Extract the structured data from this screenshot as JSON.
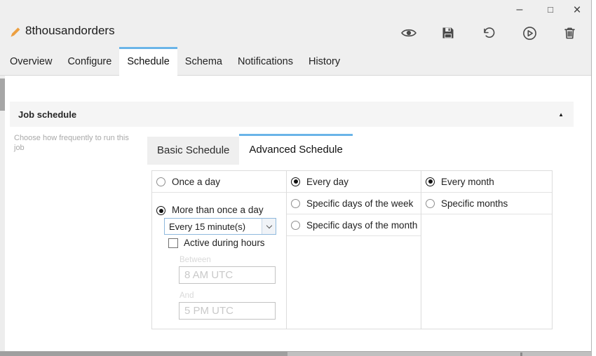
{
  "window": {
    "title": "8thousandorders",
    "controls": {
      "minimize_glyph": "–",
      "maximize_glyph": "□",
      "close_glyph": "×"
    }
  },
  "toolbar": {
    "buttons": [
      {
        "name": "preview",
        "icon": "eye-icon"
      },
      {
        "name": "save",
        "icon": "floppy-disk-icon"
      },
      {
        "name": "undo",
        "icon": "undo-arrow-icon"
      },
      {
        "name": "run",
        "icon": "play-circle-icon"
      },
      {
        "name": "delete",
        "icon": "trash-icon"
      }
    ]
  },
  "tabs": [
    {
      "label": "Overview",
      "active": false
    },
    {
      "label": "Configure",
      "active": false
    },
    {
      "label": "Schedule",
      "active": true
    },
    {
      "label": "Schema",
      "active": false
    },
    {
      "label": "Notifications",
      "active": false
    },
    {
      "label": "History",
      "active": false
    }
  ],
  "schedule_panel": {
    "header": "Job schedule",
    "collapse_glyph": "▲",
    "description": "Choose how frequently to run this job",
    "subtabs": [
      {
        "label": "Basic Schedule",
        "active": false
      },
      {
        "label": "Advanced Schedule",
        "active": true
      }
    ],
    "frequency": {
      "options": [
        {
          "label": "Once a day",
          "selected": false
        },
        {
          "label": "More than once a day",
          "selected": true
        }
      ],
      "interval": {
        "value": "Every 15 minute(s)",
        "icon": "chevron-down-icon"
      },
      "active_hours": {
        "label": "Active during hours",
        "checked": false
      },
      "between": {
        "label": "Between",
        "value": "8 AM UTC"
      },
      "and": {
        "label": "And",
        "value": "5 PM UTC"
      }
    },
    "days": {
      "options": [
        {
          "label": "Every day",
          "selected": true
        },
        {
          "label": "Specific days of the week",
          "selected": false
        },
        {
          "label": "Specific days of the month",
          "selected": false
        }
      ]
    },
    "months": {
      "options": [
        {
          "label": "Every month",
          "selected": true
        },
        {
          "label": "Specific months",
          "selected": false
        }
      ]
    }
  },
  "colors": {
    "accent_blue": "#6ab4e8",
    "pencil_orange": "#ec9f40"
  }
}
